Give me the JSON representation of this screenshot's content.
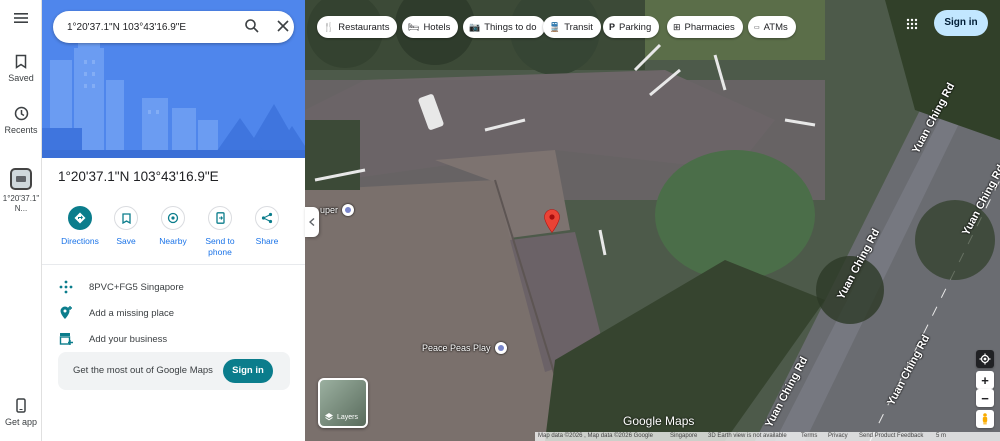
{
  "rail": {
    "saved_label": "Saved",
    "recents_label": "Recents",
    "recent_place_label": "1°20'37.1\" N...",
    "get_app_label": "Get app"
  },
  "search": {
    "value": "1°20'37.1\"N 103°43'16.9\"E"
  },
  "place": {
    "title": "1°20'37.1\"N 103°43'16.9\"E"
  },
  "actions": [
    {
      "label": "Directions",
      "icon": "directions-icon"
    },
    {
      "label": "Save",
      "icon": "bookmark-icon"
    },
    {
      "label": "Nearby",
      "icon": "nearby-icon"
    },
    {
      "label": "Send to phone",
      "icon": "phone-icon"
    },
    {
      "label": "Share",
      "icon": "share-icon"
    }
  ],
  "info": {
    "plus_code": "8PVC+FG5 Singapore",
    "add_place": "Add a missing place",
    "add_business": "Add your business"
  },
  "promo": {
    "text": "Get the most out of Google Maps",
    "signin_label": "Sign in"
  },
  "chips": [
    {
      "label": "Restaurants",
      "icon": "fork-knife-icon"
    },
    {
      "label": "Hotels",
      "icon": "bed-icon"
    },
    {
      "label": "Things to do",
      "icon": "camera-icon"
    },
    {
      "label": "Transit",
      "icon": "train-icon"
    },
    {
      "label": "Parking",
      "icon": "parking-icon"
    },
    {
      "label": "Pharmacies",
      "icon": "pharmacy-icon"
    },
    {
      "label": "ATMs",
      "icon": "atm-icon"
    }
  ],
  "header": {
    "signin_label": "Sign in"
  },
  "map": {
    "poi_super": "uper",
    "poi_peace": "Peace Peas Play",
    "road_name": "Yuan Ching Rd",
    "layers_label": "Layers",
    "logo": "Google Maps"
  },
  "footer": {
    "map_data": "Map data ©2026 , Map data ©2026 Google",
    "region": "Singapore",
    "earth_view": "3D Earth view is not available",
    "terms": "Terms",
    "privacy": "Privacy",
    "feedback": "Send Product Feedback",
    "scale": "5 m"
  },
  "colors": {
    "accent_teal": "#0b7d8c",
    "link_blue": "#1a73e8",
    "signin_bg": "#c2e7ff",
    "pin_red": "#ea4335"
  }
}
